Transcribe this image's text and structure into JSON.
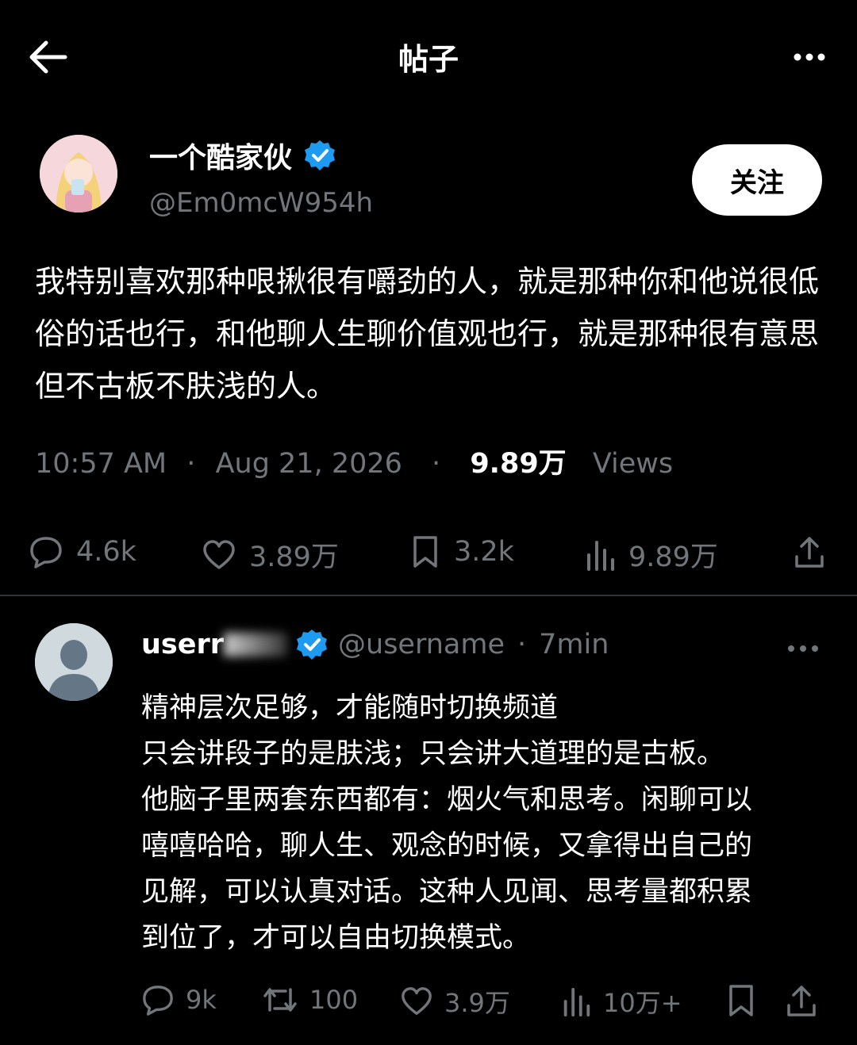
{
  "header": {
    "title": "帖子"
  },
  "post": {
    "author_name": "一个酷家伙",
    "author_handle": "@Em0mcW954h",
    "follow_label": "关注",
    "text": "我特别喜欢那种哏揪很有嚼劲的人，就是那种你和他说很低俗的话也行，和他聊人生聊价值观也行，就是那种很有意思 但不古板不肤浅的人。",
    "time": "10:57 AM",
    "date": "Aug 21, 2026",
    "views_count": "9.89万",
    "views_label": "Views",
    "actions": {
      "replies": "4.6k",
      "likes": "3.89万",
      "bookmarks": "3.2k",
      "views": "9.89万"
    }
  },
  "reply": {
    "name_visible": "userr",
    "handle": "@username",
    "time": "7min",
    "lines": [
      "精神层次足够，才能随时切换频道",
      "只会讲段子的是肤浅；只会讲大道理的是古板。",
      "他脑子里两套东西都有：烟火气和思考。闲聊可以",
      "嘻嘻哈哈，聊人生、观念的时候，又拿得出自己的",
      "见解，可以认真对话。这种人见闻、思考量都积累",
      "到位了，才可以自由切换模式。"
    ],
    "actions": {
      "replies": "9k",
      "reposts": "100",
      "likes": "3.9万",
      "views": "10万+"
    }
  },
  "colors": {
    "accent": "#1d9bf0",
    "muted": "#71767b",
    "background": "#000000"
  },
  "icons": [
    "back-arrow-icon",
    "more-icon",
    "verified-badge-icon",
    "reply-icon",
    "like-icon",
    "bookmark-icon",
    "views-icon",
    "share-icon",
    "repost-icon",
    "avatar-placeholder-icon"
  ]
}
